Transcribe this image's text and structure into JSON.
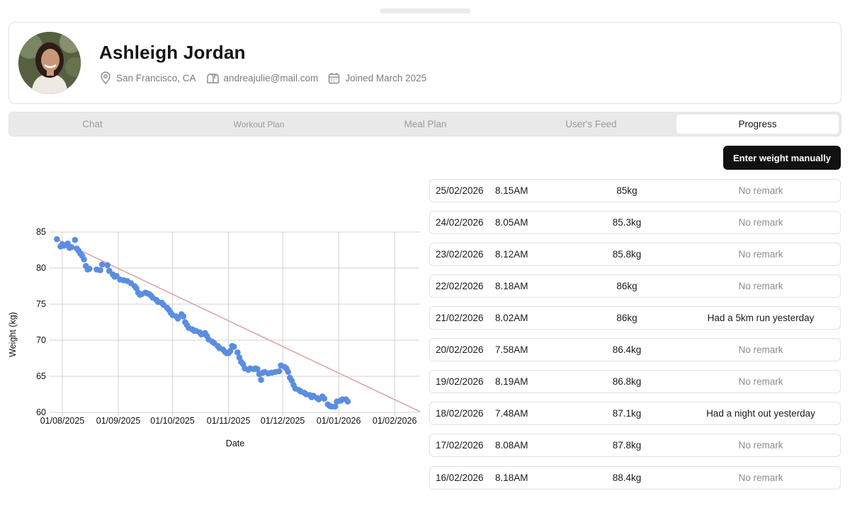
{
  "profile": {
    "name": "Ashleigh Jordan",
    "location": "San Francisco, CA",
    "email": "andreajulie@mail.com",
    "joined": "Joined March 2025"
  },
  "tabs": [
    {
      "label": "Chat",
      "active": false
    },
    {
      "label": "Workout Plan",
      "active": false
    },
    {
      "label": "Meal Plan",
      "active": false
    },
    {
      "label": "User's Feed",
      "active": false
    },
    {
      "label": "Progress",
      "active": true
    }
  ],
  "actions": {
    "enter_weight_label": "Enter weight manually"
  },
  "entries": [
    {
      "date": "25/02/2026",
      "time": "8.15AM",
      "weight": "85kg",
      "remark": "No remark"
    },
    {
      "date": "24/02/2026",
      "time": "8.05AM",
      "weight": "85.3kg",
      "remark": "No remark"
    },
    {
      "date": "23/02/2026",
      "time": "8.12AM",
      "weight": "85.8kg",
      "remark": "No remark"
    },
    {
      "date": "22/02/2026",
      "time": "8.18AM",
      "weight": "86kg",
      "remark": "No remark"
    },
    {
      "date": "21/02/2026",
      "time": "8.02AM",
      "weight": "86kg",
      "remark": "Had a 5km run yesterday"
    },
    {
      "date": "20/02/2026",
      "time": "7.58AM",
      "weight": "86.4kg",
      "remark": "No remark"
    },
    {
      "date": "19/02/2026",
      "time": "8.19AM",
      "weight": "86.8kg",
      "remark": "No remark"
    },
    {
      "date": "18/02/2026",
      "time": "7.48AM",
      "weight": "87.1kg",
      "remark": "Had a night out yesterday"
    },
    {
      "date": "17/02/2026",
      "time": "8.08AM",
      "weight": "87.8kg",
      "remark": "No remark"
    },
    {
      "date": "16/02/2026",
      "time": "8.18AM",
      "weight": "88.4kg",
      "remark": "No remark"
    }
  ],
  "colors": {
    "point": "#5b8de0",
    "trend": "#e0a0a0",
    "grid": "#d0d0d0",
    "button": "#111111"
  },
  "chart_data": {
    "type": "scatter",
    "xlabel": "Date",
    "ylabel": "Weight (kg)",
    "ylim": [
      60,
      85
    ],
    "y_ticks": [
      85,
      80,
      75,
      70,
      65,
      60
    ],
    "x_ticks": [
      "01/08/2025",
      "01/09/2025",
      "01/10/2025",
      "01/11/2025",
      "01/12/2025",
      "01/01/2026",
      "01/02/2026"
    ],
    "xlim": [
      "2025-07-28",
      "2026-02-16"
    ],
    "grid": true,
    "trendline": {
      "start": [
        "2025-07-28",
        84.1
      ],
      "end": [
        "2026-02-15",
        60.1
      ]
    },
    "points": [
      [
        "2025-07-29",
        84
      ],
      [
        "2025-07-31",
        83
      ],
      [
        "2025-08-01",
        83.3
      ],
      [
        "2025-08-02",
        83.1
      ],
      [
        "2025-08-04",
        83.4
      ],
      [
        "2025-08-05",
        82.8
      ],
      [
        "2025-08-06",
        82.9
      ],
      [
        "2025-08-08",
        83.9
      ],
      [
        "2025-08-09",
        82.7
      ],
      [
        "2025-08-10",
        82.4
      ],
      [
        "2025-08-11",
        82
      ],
      [
        "2025-08-12",
        81.7
      ],
      [
        "2025-08-13",
        81.2
      ],
      [
        "2025-08-14",
        80.3
      ],
      [
        "2025-08-15",
        79.8
      ],
      [
        "2025-08-16",
        79.9
      ],
      [
        "2025-08-20",
        79.8
      ],
      [
        "2025-08-22",
        79.7
      ],
      [
        "2025-08-23",
        80.5
      ],
      [
        "2025-08-26",
        80.4
      ],
      [
        "2025-08-27",
        79.6
      ],
      [
        "2025-08-29",
        79.1
      ],
      [
        "2025-08-30",
        78.8
      ],
      [
        "2025-08-31",
        78.9
      ],
      [
        "2025-09-02",
        78.4
      ],
      [
        "2025-09-04",
        78.3
      ],
      [
        "2025-09-06",
        78.2
      ],
      [
        "2025-09-08",
        77.9
      ],
      [
        "2025-09-10",
        77.5
      ],
      [
        "2025-09-11",
        77.2
      ],
      [
        "2025-09-12",
        76.6
      ],
      [
        "2025-09-13",
        76.3
      ],
      [
        "2025-09-14",
        76.4
      ],
      [
        "2025-09-16",
        76.6
      ],
      [
        "2025-09-17",
        76.5
      ],
      [
        "2025-09-18",
        76.4
      ],
      [
        "2025-09-19",
        76.2
      ],
      [
        "2025-09-20",
        75.9
      ],
      [
        "2025-09-22",
        75.6
      ],
      [
        "2025-09-23",
        75.3
      ],
      [
        "2025-09-25",
        75.2
      ],
      [
        "2025-09-26",
        74.9
      ],
      [
        "2025-09-28",
        74.5
      ],
      [
        "2025-09-29",
        74.2
      ],
      [
        "2025-09-30",
        73.8
      ],
      [
        "2025-10-01",
        73.5
      ],
      [
        "2025-10-03",
        73.3
      ],
      [
        "2025-10-04",
        73
      ],
      [
        "2025-10-06",
        73.6
      ],
      [
        "2025-10-07",
        73.3
      ],
      [
        "2025-10-08",
        72.5
      ],
      [
        "2025-10-09",
        72.1
      ],
      [
        "2025-10-10",
        71.7
      ],
      [
        "2025-10-12",
        71.5
      ],
      [
        "2025-10-13",
        71.3
      ],
      [
        "2025-10-14",
        71.3
      ],
      [
        "2025-10-16",
        71.1
      ],
      [
        "2025-10-17",
        70.8
      ],
      [
        "2025-10-19",
        71
      ],
      [
        "2025-10-20",
        70.6
      ],
      [
        "2025-10-21",
        70.1
      ],
      [
        "2025-10-23",
        69.8
      ],
      [
        "2025-10-24",
        69.6
      ],
      [
        "2025-10-26",
        69.2
      ],
      [
        "2025-10-27",
        68.9
      ],
      [
        "2025-10-29",
        68.7
      ],
      [
        "2025-10-30",
        68.4
      ],
      [
        "2025-10-31",
        68.2
      ],
      [
        "2025-11-01",
        68.2
      ],
      [
        "2025-11-02",
        68.5
      ],
      [
        "2025-11-03",
        69.2
      ],
      [
        "2025-11-04",
        69.1
      ],
      [
        "2025-11-06",
        68.3
      ],
      [
        "2025-11-07",
        67.6
      ],
      [
        "2025-11-08",
        67
      ],
      [
        "2025-11-09",
        66.7
      ],
      [
        "2025-11-10",
        66.1
      ],
      [
        "2025-11-12",
        65.9
      ],
      [
        "2025-11-13",
        66.1
      ],
      [
        "2025-11-15",
        66
      ],
      [
        "2025-11-16",
        66.1
      ],
      [
        "2025-11-17",
        66
      ],
      [
        "2025-11-18",
        65.3
      ],
      [
        "2025-11-19",
        64.5
      ],
      [
        "2025-11-20",
        65.5
      ],
      [
        "2025-11-21",
        65.6
      ],
      [
        "2025-11-23",
        65.4
      ],
      [
        "2025-11-25",
        65.5
      ],
      [
        "2025-11-27",
        65.6
      ],
      [
        "2025-11-29",
        65.7
      ],
      [
        "2025-11-30",
        66.5
      ],
      [
        "2025-12-02",
        66.3
      ],
      [
        "2025-12-03",
        66.1
      ],
      [
        "2025-12-04",
        65.6
      ],
      [
        "2025-12-05",
        64.8
      ],
      [
        "2025-12-06",
        64.4
      ],
      [
        "2025-12-07",
        63.8
      ],
      [
        "2025-12-08",
        63.3
      ],
      [
        "2025-12-10",
        63.1
      ],
      [
        "2025-12-11",
        62.9
      ],
      [
        "2025-12-13",
        62.7
      ],
      [
        "2025-12-14",
        62.5
      ],
      [
        "2025-12-16",
        62.4
      ],
      [
        "2025-12-17",
        62.1
      ],
      [
        "2025-12-18",
        62.3
      ],
      [
        "2025-12-20",
        62
      ],
      [
        "2025-12-21",
        61.8
      ],
      [
        "2025-12-23",
        62.2
      ],
      [
        "2025-12-24",
        61.9
      ],
      [
        "2025-12-26",
        61.1
      ],
      [
        "2025-12-27",
        60.9
      ],
      [
        "2025-12-28",
        60.8
      ],
      [
        "2025-12-30",
        60.8
      ],
      [
        "2025-12-31",
        61.5
      ],
      [
        "2026-01-02",
        61.6
      ],
      [
        "2026-01-03",
        61.8
      ],
      [
        "2026-01-05",
        61.8
      ],
      [
        "2026-01-06",
        61.5
      ]
    ]
  }
}
